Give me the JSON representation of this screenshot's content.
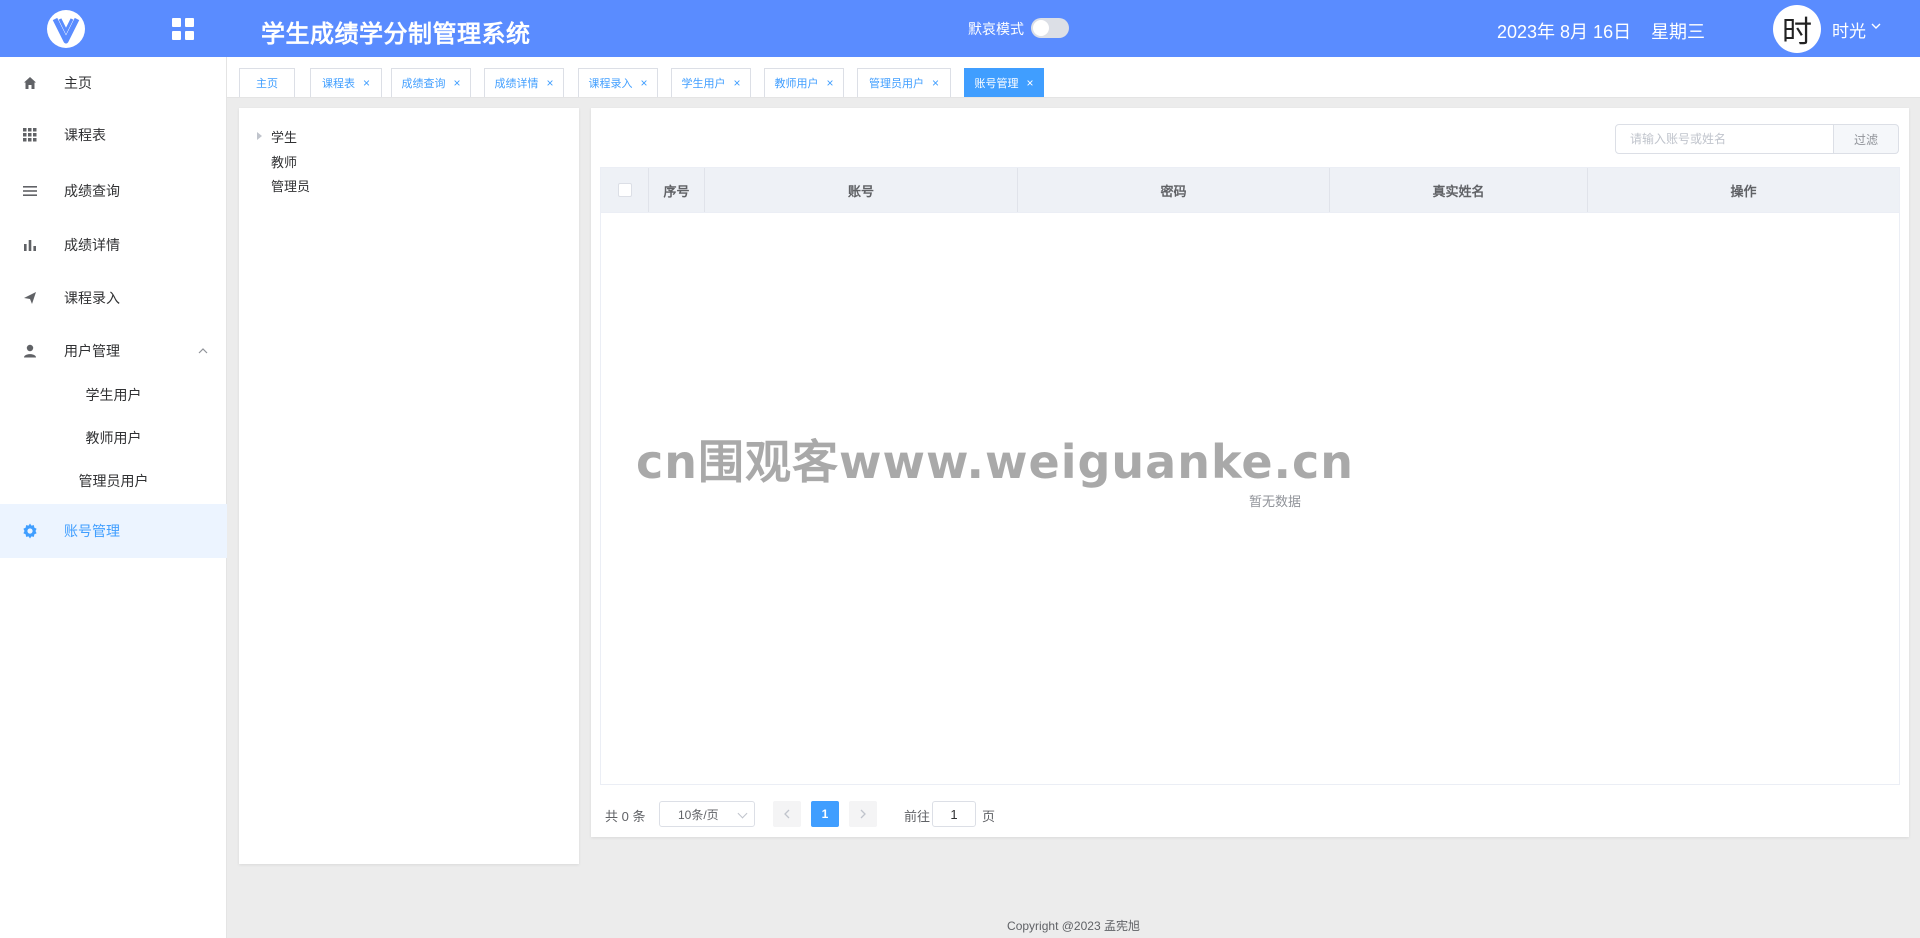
{
  "header": {
    "title": "学生成绩学分制管理系统",
    "mode_label": "默哀模式",
    "mode_on": false,
    "date": "2023年 8月 16日",
    "weekday": "星期三",
    "avatar_char": "时",
    "username": "时光",
    "brand_color": "#5a8cff"
  },
  "sidebar": {
    "items": [
      {
        "label": "主页",
        "icon": "home-icon"
      },
      {
        "label": "课程表",
        "icon": "grid-icon"
      },
      {
        "label": "成绩查询",
        "icon": "list-icon"
      },
      {
        "label": "成绩详情",
        "icon": "bar-chart-icon"
      },
      {
        "label": "课程录入",
        "icon": "send-icon"
      },
      {
        "label": "用户管理",
        "icon": "user-icon"
      },
      {
        "label": "账号管理",
        "icon": "gear-icon"
      }
    ],
    "subitems": [
      {
        "label": "学生用户"
      },
      {
        "label": "教师用户"
      },
      {
        "label": "管理员用户"
      }
    ],
    "active": "账号管理"
  },
  "tabs": [
    {
      "label": "主页"
    },
    {
      "label": "课程表"
    },
    {
      "label": "成绩查询"
    },
    {
      "label": "成绩详情"
    },
    {
      "label": "课程录入"
    },
    {
      "label": "学生用户"
    },
    {
      "label": "教师用户"
    },
    {
      "label": "管理员用户"
    },
    {
      "label": "账号管理"
    }
  ],
  "tree": {
    "nodes": [
      {
        "label": "学生"
      },
      {
        "label": "教师"
      },
      {
        "label": "管理员"
      }
    ]
  },
  "search": {
    "placeholder": "请输入账号或姓名",
    "button": "过滤"
  },
  "table": {
    "columns": [
      "序号",
      "账号",
      "密码",
      "真实姓名",
      "操作"
    ],
    "empty_text": "暂无数据"
  },
  "pagination": {
    "total": "共 0 条",
    "page_size": "10条/页",
    "current_page": "1",
    "goto_label": "前往",
    "goto_value": "1",
    "goto_unit": "页"
  },
  "watermark": "cn围观客www.weiguanke.cn",
  "footer": "Copyright @2023 孟宪旭"
}
